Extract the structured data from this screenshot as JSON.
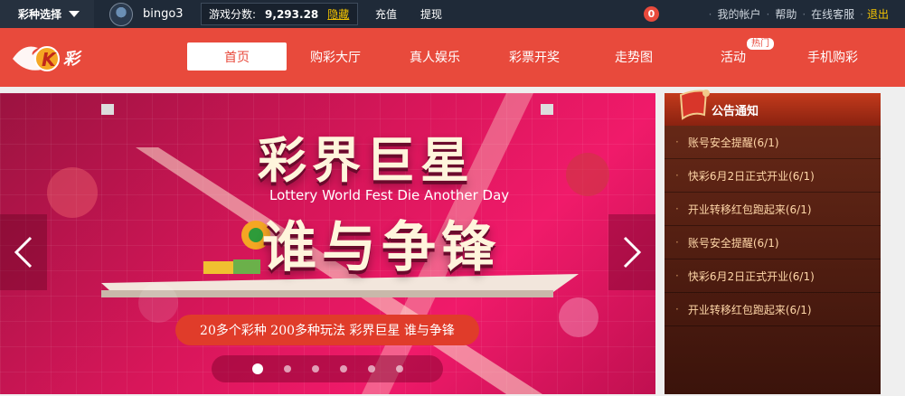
{
  "topbar": {
    "lottery_select": "彩种选择",
    "username": "bingo3",
    "score_label": "游戏分数:",
    "score_value": "9,293.28",
    "hide_label": "隐藏",
    "recharge": "充值",
    "withdraw": "提现",
    "message_count": "0",
    "links": [
      "我的帐户",
      "帮助",
      "在线客服"
    ],
    "logout": "退出"
  },
  "nav": {
    "logo_text": "彩",
    "items": [
      "首页",
      "购彩大厅",
      "真人娱乐",
      "彩票开奖",
      "走势图",
      "活动",
      "手机购彩"
    ],
    "hot_badge": "热门"
  },
  "banner": {
    "headline_1": "彩界巨星",
    "subline": "Lottery World Fest Die Another Day",
    "headline_2": "谁与争锋",
    "slogan": "20多个彩种 200多种玩法 彩界巨星 谁与争锋",
    "slide_count": 6,
    "active_slide": 1
  },
  "notice": {
    "title": "公告通知",
    "items": [
      "账号安全提醒(6/1)",
      "快彩6月2日正式开业(6/1)",
      "开业转移红包跑起来(6/1)",
      "账号安全提醒(6/1)",
      "快彩6月2日正式开业(6/1)",
      "开业转移红包跑起来(6/1)"
    ]
  }
}
